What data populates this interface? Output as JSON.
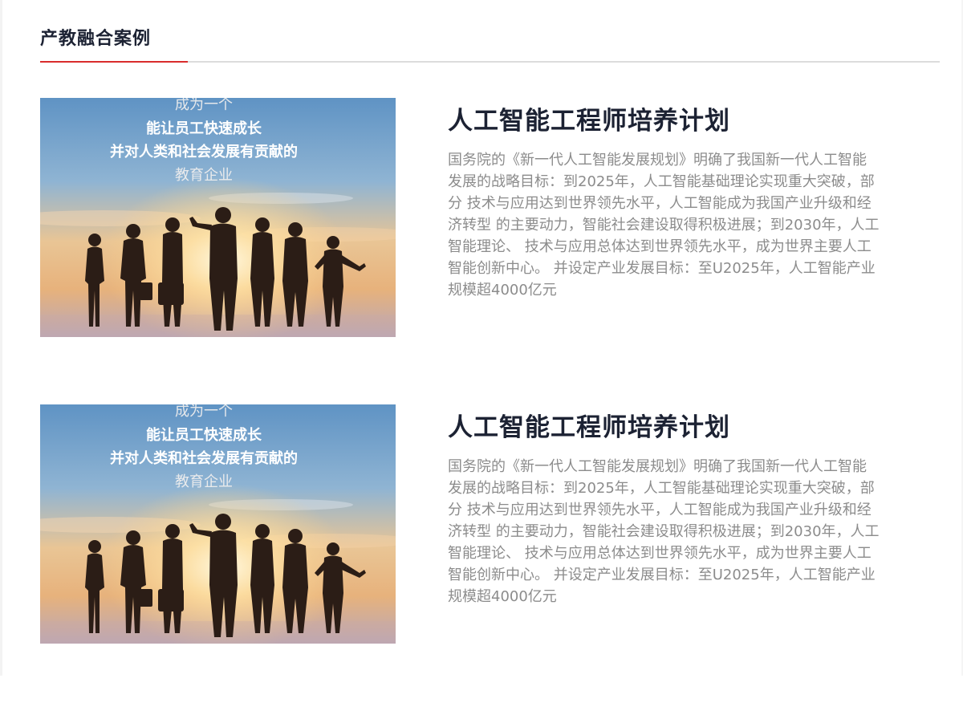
{
  "section": {
    "title": "产教融合案例"
  },
  "cases": [
    {
      "title": "人工智能工程师培养计划",
      "image_text": [
        "成为一个",
        "能让员工快速成长",
        "并对人类和社会发展有贡献的",
        "教育企业"
      ],
      "description": "国务院的《新一代人工智能发展规划》明确了我国新一代人工智能 发展的战略目标：到2025年，人工智能基础理论实现重大突破，部分 技术与应用达到世界领先水平，人工智能成为我国产业升级和经济转型 的主要动力，智能社会建设取得积极进展；到2030年，人工智能理论、 技术与应用总体达到世界领先水平，成为世界主要人工智能创新中心。 并设定产业发展目标：至U2025年，人工智能产业规模超4000亿元"
    },
    {
      "title": "人工智能工程师培养计划",
      "image_text": [
        "成为一个",
        "能让员工快速成长",
        "并对人类和社会发展有贡献的",
        "教育企业"
      ],
      "description": "国务院的《新一代人工智能发展规划》明确了我国新一代人工智能 发展的战略目标：到2025年，人工智能基础理论实现重大突破，部分 技术与应用达到世界领先水平，人工智能成为我国产业升级和经济转型 的主要动力，智能社会建设取得积极进展；到2030年，人工智能理论、 技术与应用总体达到世界领先水平，成为世界主要人工智能创新中心。 并设定产业发展目标：至U2025年，人工智能产业规模超4000亿元"
    }
  ],
  "colors": {
    "accent": "#d92c2c",
    "title": "#1c2233",
    "body_text": "#8c8c8c",
    "divider": "#dcdcdc"
  }
}
